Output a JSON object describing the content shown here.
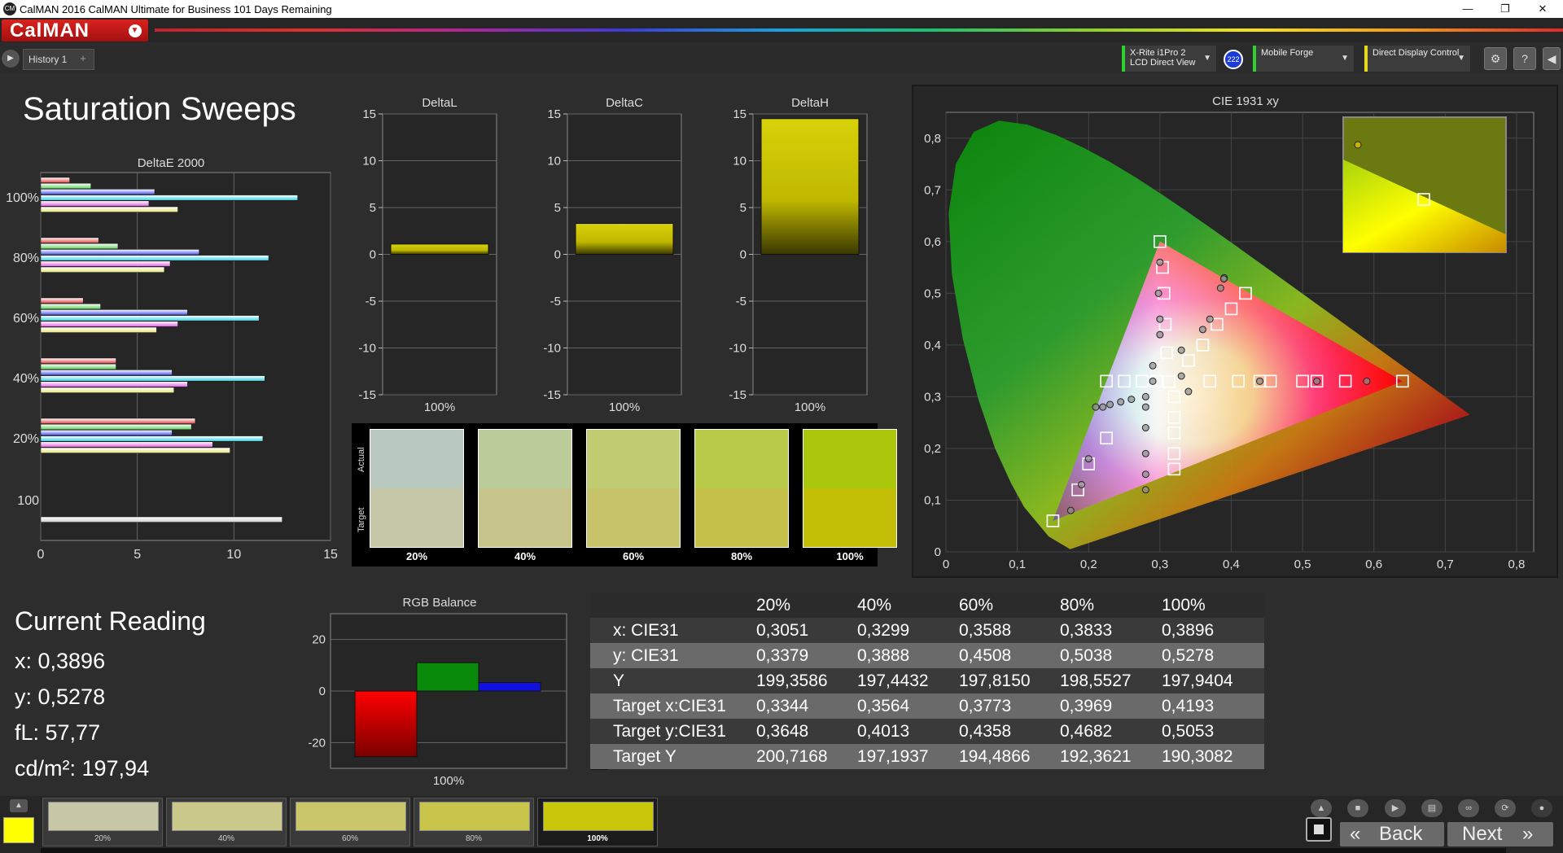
{
  "window": {
    "title": "CalMAN 2016 CalMAN Ultimate for Business 101 Days Remaining",
    "app_icon_text": "CM"
  },
  "logo": "CalMAN",
  "tabs": {
    "history": "History 1",
    "add": "+"
  },
  "devices": {
    "meter_line1": "X-Rite i1Pro 2",
    "meter_line2": "LCD Direct View",
    "badge": "222",
    "source": "Mobile Forge",
    "display": "Direct Display Control"
  },
  "page_title": "Saturation Sweeps",
  "deltae_chart": {
    "title": "DeltaE 2000",
    "xticks": [
      "0",
      "5",
      "10",
      "15"
    ],
    "groups": [
      "100%",
      "80%",
      "60%",
      "40%",
      "20%",
      "100"
    ]
  },
  "delta_charts": [
    {
      "title": "DeltaL",
      "category": "100%",
      "yticks": [
        "15",
        "10",
        "5",
        "0",
        "-5",
        "-10",
        "-15"
      ]
    },
    {
      "title": "DeltaC",
      "category": "100%",
      "yticks": [
        "15",
        "10",
        "5",
        "0",
        "-5",
        "-10",
        "-15"
      ]
    },
    {
      "title": "DeltaH",
      "category": "100%",
      "yticks": [
        "15",
        "10",
        "5",
        "0",
        "-5",
        "-10",
        "-15"
      ]
    }
  ],
  "swatches": {
    "actual_label": "Actual",
    "target_label": "Target",
    "items": [
      {
        "label": "20%",
        "actual": "#b9c9bf",
        "target": "#c6c7a9"
      },
      {
        "label": "40%",
        "actual": "#bccb9a",
        "target": "#c7c58b"
      },
      {
        "label": "60%",
        "actual": "#bfcc72",
        "target": "#c7c36a"
      },
      {
        "label": "80%",
        "actual": "#b7cb48",
        "target": "#c4c04a"
      },
      {
        "label": "100%",
        "actual": "#aac70c",
        "target": "#c2bf06"
      }
    ]
  },
  "cie": {
    "title": "CIE 1931 xy",
    "xticks": [
      "0",
      "0,1",
      "0,2",
      "0,3",
      "0,4",
      "0,5",
      "0,6",
      "0,7",
      "0,8"
    ],
    "yticks": [
      "0",
      "0,1",
      "0,2",
      "0,3",
      "0,4",
      "0,5",
      "0,6",
      "0,7",
      "0,8"
    ]
  },
  "current_reading": {
    "title": "Current Reading",
    "x": "x: 0,3896",
    "y": "y: 0,5278",
    "fl": "fL: 57,77",
    "cdm2": "cd/m²: 197,94"
  },
  "rgb_balance": {
    "title": "RGB Balance",
    "yticks": [
      "20",
      "0",
      "-20"
    ],
    "category": "100%"
  },
  "table": {
    "columns": [
      "20%",
      "40%",
      "60%",
      "80%",
      "100%"
    ],
    "rows": [
      {
        "label": "x: CIE31",
        "values": [
          "0,3051",
          "0,3299",
          "0,3588",
          "0,3833",
          "0,3896"
        ]
      },
      {
        "label": "y: CIE31",
        "values": [
          "0,3379",
          "0,3888",
          "0,4508",
          "0,5038",
          "0,5278"
        ]
      },
      {
        "label": "Y",
        "values": [
          "199,3586",
          "197,4432",
          "197,8150",
          "198,5527",
          "197,9404"
        ]
      },
      {
        "label": "Target x:CIE31",
        "values": [
          "0,3344",
          "0,3564",
          "0,3773",
          "0,3969",
          "0,4193"
        ]
      },
      {
        "label": "Target y:CIE31",
        "values": [
          "0,3648",
          "0,4013",
          "0,4358",
          "0,4682",
          "0,5053"
        ]
      },
      {
        "label": "Target Y",
        "values": [
          "200,7168",
          "197,1937",
          "194,4866",
          "192,3621",
          "190,3082"
        ]
      }
    ]
  },
  "patches": [
    {
      "label": "20%",
      "color": "#c9c8a6"
    },
    {
      "label": "40%",
      "color": "#cbc98a"
    },
    {
      "label": "60%",
      "color": "#c9c76a"
    },
    {
      "label": "80%",
      "color": "#c8c54a"
    },
    {
      "label": "100%",
      "color": "#c8c70a"
    }
  ],
  "nav": {
    "back": "Back",
    "next": "Next"
  },
  "chart_data": [
    {
      "type": "bar",
      "title": "DeltaE 2000",
      "orientation": "horizontal",
      "xlim": [
        0,
        15
      ],
      "categories": [
        "100%",
        "80%",
        "60%",
        "40%",
        "20%",
        "100"
      ],
      "series": [
        {
          "values": [
            1.5,
            3.0,
            2.2,
            3.9,
            8.0,
            null
          ]
        },
        {
          "values": [
            2.6,
            4.0,
            3.1,
            3.9,
            7.8,
            null
          ]
        },
        {
          "values": [
            5.9,
            8.2,
            7.6,
            6.8,
            6.8,
            null
          ]
        },
        {
          "values": [
            13.3,
            11.8,
            11.3,
            11.6,
            11.5,
            12.5
          ]
        },
        {
          "values": [
            5.6,
            6.7,
            7.1,
            7.6,
            8.9,
            null
          ]
        },
        {
          "values": [
            7.1,
            6.4,
            6.0,
            6.9,
            9.8,
            null
          ]
        }
      ],
      "colors": [
        "#e0484c",
        "#5fd15f",
        "#4a55e8",
        "#3fd0e0",
        "#e060e0",
        "#e6e680"
      ]
    },
    {
      "type": "bar",
      "title": "DeltaL",
      "categories": [
        "100%"
      ],
      "values": [
        1.1
      ],
      "ylim": [
        -15,
        15
      ]
    },
    {
      "type": "bar",
      "title": "DeltaC",
      "categories": [
        "100%"
      ],
      "values": [
        3.3
      ],
      "ylim": [
        -15,
        15
      ]
    },
    {
      "type": "bar",
      "title": "DeltaH",
      "categories": [
        "100%"
      ],
      "values": [
        14.5
      ],
      "ylim": [
        -15,
        15
      ]
    },
    {
      "type": "bar",
      "title": "RGB Balance",
      "categories": [
        "100%"
      ],
      "series": [
        {
          "values": [
            -25.5
          ]
        },
        {
          "values": [
            11
          ]
        },
        {
          "values": [
            3.3
          ]
        }
      ],
      "colors": [
        "#ff0000",
        "#0a8a0a",
        "#1010e0"
      ],
      "ylim": [
        -30,
        30
      ]
    },
    {
      "type": "scatter",
      "title": "CIE 1931 xy",
      "xlim": [
        0,
        0.8
      ],
      "ylim": [
        0,
        0.85
      ],
      "targets": [
        [
          0.3127,
          0.329
        ],
        [
          0.3,
          0.6
        ],
        [
          0.64,
          0.33
        ],
        [
          0.15,
          0.06
        ],
        [
          0.3036,
          0.55
        ],
        [
          0.3056,
          0.5
        ],
        [
          0.3075,
          0.44
        ],
        [
          0.3095,
          0.385
        ],
        [
          0.5,
          0.33
        ],
        [
          0.455,
          0.33
        ],
        [
          0.41,
          0.33
        ],
        [
          0.37,
          0.33
        ],
        [
          0.225,
          0.33
        ],
        [
          0.25,
          0.33
        ],
        [
          0.275,
          0.33
        ],
        [
          0.295,
          0.33
        ],
        [
          0.225,
          0.22
        ],
        [
          0.2,
          0.17
        ],
        [
          0.185,
          0.12
        ],
        [
          0.42,
          0.5
        ],
        [
          0.4,
          0.47
        ],
        [
          0.38,
          0.44
        ],
        [
          0.36,
          0.4
        ],
        [
          0.34,
          0.37
        ],
        [
          0.32,
          0.3
        ],
        [
          0.32,
          0.26
        ],
        [
          0.32,
          0.23
        ],
        [
          0.32,
          0.19
        ],
        [
          0.32,
          0.16
        ],
        [
          0.56,
          0.33
        ],
        [
          0.52,
          0.33
        ],
        [
          0.44,
          0.33
        ]
      ],
      "measured": [
        [
          0.3,
          0.56
        ],
        [
          0.298,
          0.5
        ],
        [
          0.3,
          0.45
        ],
        [
          0.3,
          0.42
        ],
        [
          0.39,
          0.53
        ],
        [
          0.385,
          0.51
        ],
        [
          0.37,
          0.45
        ],
        [
          0.36,
          0.43
        ],
        [
          0.33,
          0.39
        ],
        [
          0.33,
          0.34
        ],
        [
          0.34,
          0.31
        ],
        [
          0.29,
          0.36
        ],
        [
          0.29,
          0.33
        ],
        [
          0.28,
          0.3
        ],
        [
          0.26,
          0.295
        ],
        [
          0.245,
          0.29
        ],
        [
          0.23,
          0.285
        ],
        [
          0.22,
          0.28
        ],
        [
          0.21,
          0.28
        ],
        [
          0.2,
          0.18
        ],
        [
          0.19,
          0.13
        ],
        [
          0.175,
          0.08
        ],
        [
          0.28,
          0.28
        ],
        [
          0.28,
          0.24
        ],
        [
          0.28,
          0.19
        ],
        [
          0.28,
          0.15
        ],
        [
          0.28,
          0.12
        ],
        [
          0.59,
          0.33
        ],
        [
          0.52,
          0.33
        ],
        [
          0.44,
          0.33
        ],
        [
          0.3896,
          0.5278
        ]
      ]
    }
  ]
}
